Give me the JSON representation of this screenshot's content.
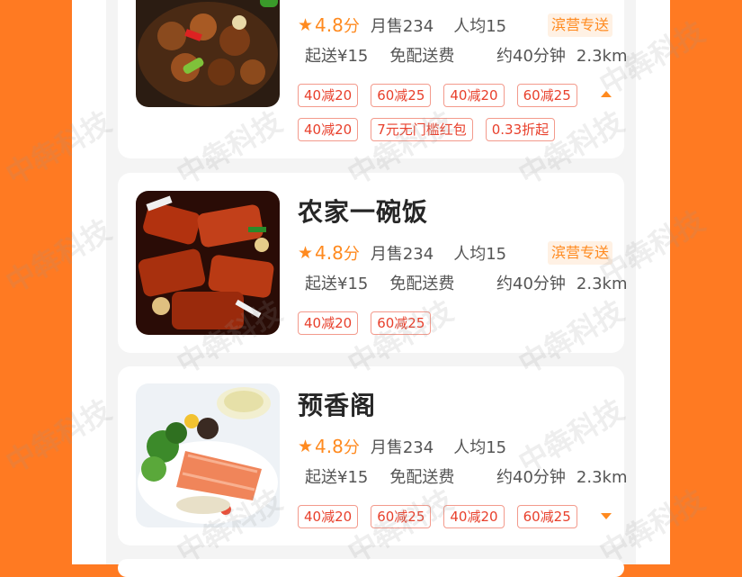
{
  "restaurants": [
    {
      "name": "",
      "rating": "4.8",
      "rating_unit": "分",
      "sales": "月售234",
      "avg_price": "人均15",
      "badge": "滨营专送",
      "min_order": "起送¥15",
      "delivery_fee": "免配送费",
      "time": "约40分钟",
      "distance": "2.3km",
      "tags_row1": [
        "40减20",
        "60减25",
        "40减20",
        "60减25"
      ],
      "tags_row2": [
        "40减20",
        "7元无门槛红包",
        "0.33折起"
      ],
      "toggle_icon": "caret-up-icon"
    },
    {
      "name": "农家一碗饭",
      "rating": "4.8",
      "rating_unit": "分",
      "sales": "月售234",
      "avg_price": "人均15",
      "badge": "滨营专送",
      "min_order": "起送¥15",
      "delivery_fee": "免配送费",
      "time": "约40分钟",
      "distance": "2.3km",
      "tags_row1": [
        "40减20",
        "60减25"
      ]
    },
    {
      "name": "预香阁",
      "rating": "4.8",
      "rating_unit": "分",
      "sales": "月售234",
      "avg_price": "人均15",
      "min_order": "起送¥15",
      "delivery_fee": "免配送费",
      "time": "约40分钟",
      "distance": "2.3km",
      "tags_row1": [
        "40减20",
        "60减25",
        "40减20",
        "60减25"
      ],
      "toggle_icon": "caret-down-icon"
    }
  ],
  "watermark": "中犇科技",
  "colors": {
    "accent": "#ff8a1f",
    "background": "#ff7a22",
    "tag_text": "#e8402c"
  }
}
